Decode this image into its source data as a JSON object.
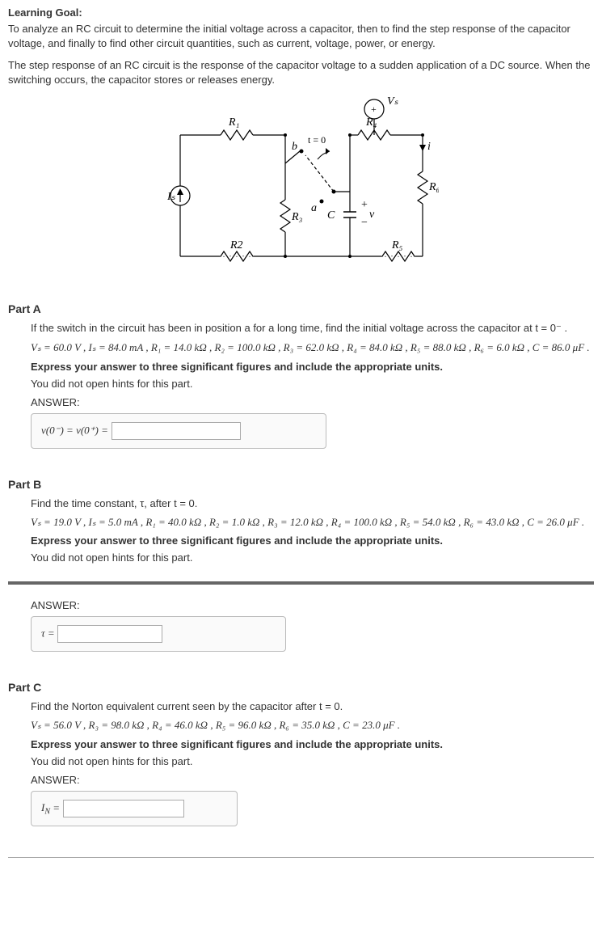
{
  "learningGoal": {
    "heading": "Learning Goal:",
    "para1": "To analyze an RC circuit to determine the initial voltage across a capacitor, then to find the step response of the capacitor voltage, and finally to find other circuit quantities, such as current, voltage, power, or energy.",
    "para2": "The step response of an RC circuit is the response of the capacitor voltage to a sudden application of a DC source. When the switching occurs, the capacitor stores or releases energy."
  },
  "circuit": {
    "labels": {
      "Is": "Iₛ",
      "R1": "R₁",
      "R2": "R2",
      "R3": "R₃",
      "R4": "R₄",
      "R5": "R₅",
      "R6": "R₆",
      "Vs": "Vₛ",
      "C": "C",
      "v": "v",
      "plus": "+",
      "minus": "−",
      "i": "i",
      "t0": "t = 0",
      "a": "a",
      "b": "b"
    }
  },
  "partA": {
    "heading": "Part A",
    "prompt": "If the switch in the circuit has been in position a for a long time, find the initial voltage across the capacitor at t = 0⁻ .",
    "values": "Vₛ = 60.0 V , Iₛ = 84.0 mA , R₁ = 14.0 kΩ , R₂ = 100.0 kΩ , R₃ = 62.0 kΩ , R₄ = 84.0 kΩ , R₅ = 88.0 kΩ , R₆ = 6.0 kΩ , C = 86.0 μF .",
    "express": "Express your answer to three significant figures and include the appropriate units.",
    "hints": "You did not open hints for this part.",
    "answerLabel": "ANSWER:",
    "eq": "v(0⁻) = v(0⁺) ="
  },
  "partB": {
    "heading": "Part B",
    "prompt": "Find the time constant, τ, after t = 0.",
    "values": "Vₛ = 19.0 V , Iₛ = 5.0 mA , R₁ = 40.0 kΩ , R₂ = 1.0 kΩ , R₃ = 12.0 kΩ , R₄ = 100.0 kΩ , R₅ = 54.0 kΩ , R₆ = 43.0 kΩ , C = 26.0 μF .",
    "express": "Express your answer to three significant figures and include the appropriate units.",
    "hints": "You did not open hints for this part.",
    "answerLabel": "ANSWER:",
    "eq": "τ ="
  },
  "partC": {
    "heading": "Part C",
    "prompt": "Find the Norton equivalent current seen by the capacitor after t = 0.",
    "values": "Vₛ = 56.0 V , R₃ = 98.0 kΩ , R₄ = 46.0 kΩ , R₅ = 96.0 kΩ , R₆ = 35.0 kΩ , C = 23.0 μF .",
    "express": "Express your answer to three significant figures and include the appropriate units.",
    "hints": "You did not open hints for this part.",
    "answerLabel": "ANSWER:",
    "eq": "I_N ="
  }
}
